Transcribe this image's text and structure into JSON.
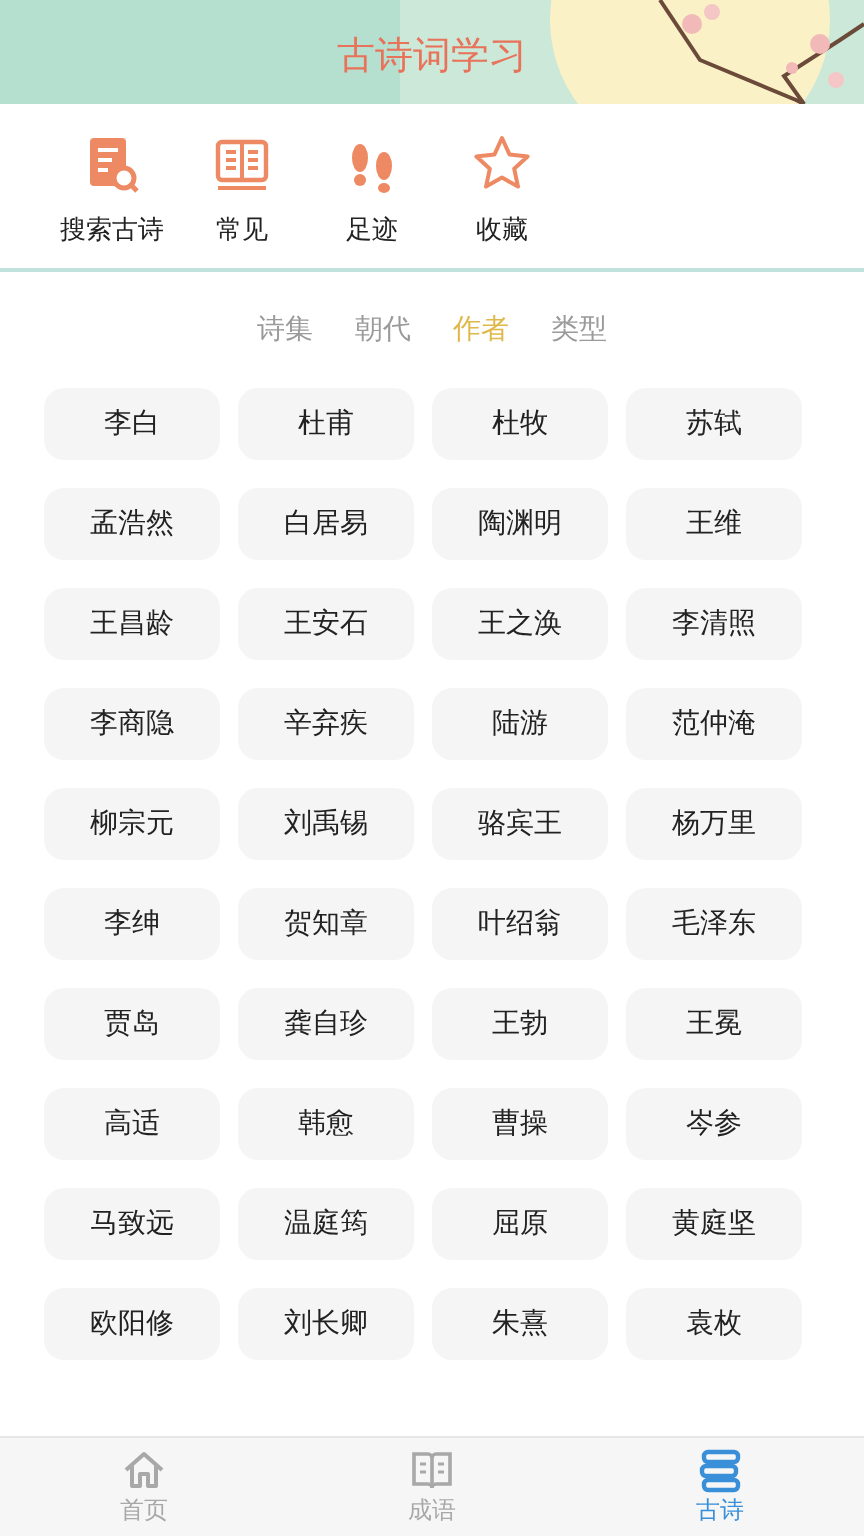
{
  "header": {
    "title": "古诗词学习"
  },
  "shortcuts": [
    {
      "kind": "search",
      "label": "搜索古诗"
    },
    {
      "kind": "book",
      "label": "常见"
    },
    {
      "kind": "footprints",
      "label": "足迹"
    },
    {
      "kind": "star",
      "label": "收藏"
    }
  ],
  "tabs": [
    {
      "label": "诗集",
      "selected": false
    },
    {
      "label": "朝代",
      "selected": false
    },
    {
      "label": "作者",
      "selected": true
    },
    {
      "label": "类型",
      "selected": false
    }
  ],
  "authors": [
    "李白",
    "杜甫",
    "杜牧",
    "苏轼",
    "孟浩然",
    "白居易",
    "陶渊明",
    "王维",
    "王昌龄",
    "王安石",
    "王之涣",
    "李清照",
    "李商隐",
    "辛弃疾",
    "陆游",
    "范仲淹",
    "柳宗元",
    "刘禹锡",
    "骆宾王",
    "杨万里",
    "李绅",
    "贺知章",
    "叶绍翁",
    "毛泽东",
    "贾岛",
    "龚自珍",
    "王勃",
    "王冕",
    "高适",
    "韩愈",
    "曹操",
    "岑参",
    "马致远",
    "温庭筠",
    "屈原",
    "黄庭坚",
    "欧阳修",
    "刘长卿",
    "朱熹",
    "袁枚"
  ],
  "bottom_nav": [
    {
      "kind": "home",
      "label": "首页",
      "selected": false
    },
    {
      "kind": "idiom",
      "label": "成语",
      "selected": false
    },
    {
      "kind": "poem",
      "label": "古诗",
      "selected": true
    }
  ]
}
